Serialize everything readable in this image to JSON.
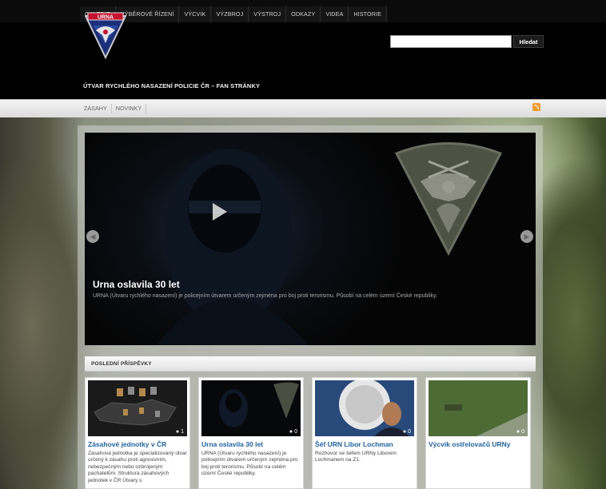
{
  "topnav": [
    "GALERIE",
    "VÝBĚROVÉ ŘÍZENÍ",
    "VÝCVIK",
    "VÝZBROJ",
    "VÝSTROJ",
    "ODKAZY",
    "VIDEA",
    "HISTORIE"
  ],
  "header": {
    "logo_text": "URNA",
    "site_title": "ÚTVAR RYCHLÉHO NASAZENÍ POLICIE ČR – FAN STRÁNKY"
  },
  "search": {
    "placeholder": "",
    "button_label": "Hledat"
  },
  "subnav": [
    "ZÁSAHY",
    "NOVINKY"
  ],
  "slider": {
    "title": "Urna oslavila 30 let",
    "excerpt": "URNA (Útvaru rychlého nasazení)  je policejním útvarem určeným zejména pro boj proti terorismu. Působí na celém území České republiky."
  },
  "latest": {
    "header": "POSLEDNÍ PŘÍSPĚVKY",
    "cards": [
      {
        "title": "Zásahové jednotky v ČR",
        "text": "Zásahová jednotka je specializovaný útvar určený k zásahu proti agresivním, nebezpečným nebo ozbrojeným pachatelům. Struktura zásahových jednotek v ČR Útvary s",
        "comments": "1"
      },
      {
        "title": "Urna oslavila 30 let",
        "text": "URNA (Útvaru rychlého nasazení)  je policejním útvarem určeným zejména pro boj proti terorismu. Působí na celém území České republiky.",
        "comments": "0"
      },
      {
        "title": "Šéf URN Libor Lochman",
        "text": "Rozhovor se šéfem URNy Liborem Lochmanem na Z1.",
        "comments": "0"
      },
      {
        "title": "Výcvik ostřelovačů URNy",
        "text": "",
        "comments": "0"
      }
    ]
  },
  "colors": {
    "link_blue": "#1f63a8",
    "rss_orange": "#f29a2b"
  }
}
